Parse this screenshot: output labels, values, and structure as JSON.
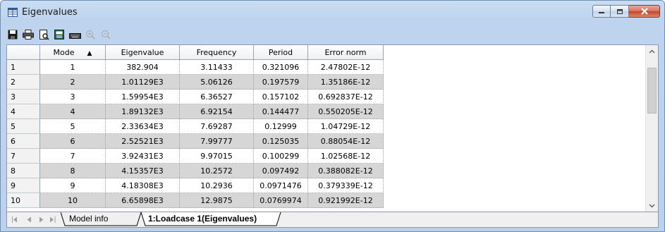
{
  "window": {
    "title": "Eigenvalues",
    "accent": "#bcd2ec",
    "close_color": "#c5432b"
  },
  "toolbar": {
    "icons": [
      "save-icon",
      "print-icon",
      "print-preview-icon",
      "export-icon",
      "keyboard-icon",
      "zoom-in-icon",
      "zoom-out-icon"
    ]
  },
  "table": {
    "columns": [
      "Mode",
      "Eigenvalue",
      "Frequency",
      "Period",
      "Error norm"
    ],
    "sort_indicator": "▲",
    "rows": [
      {
        "n": "1",
        "mode": "1",
        "eig": "382.904",
        "freq": "3.11433",
        "period": "0.321096",
        "err": "2.47802E-12"
      },
      {
        "n": "2",
        "mode": "2",
        "eig": "1.01129E3",
        "freq": "5.06126",
        "period": "0.197579",
        "err": "1.35186E-12"
      },
      {
        "n": "3",
        "mode": "3",
        "eig": "1.59954E3",
        "freq": "6.36527",
        "period": "0.157102",
        "err": "0.692837E-12"
      },
      {
        "n": "4",
        "mode": "4",
        "eig": "1.89132E3",
        "freq": "6.92154",
        "period": "0.144477",
        "err": "0.550205E-12"
      },
      {
        "n": "5",
        "mode": "5",
        "eig": "2.33634E3",
        "freq": "7.69287",
        "period": "0.12999",
        "err": "1.04729E-12"
      },
      {
        "n": "6",
        "mode": "6",
        "eig": "2.52521E3",
        "freq": "7.99777",
        "period": "0.125035",
        "err": "0.88054E-12"
      },
      {
        "n": "7",
        "mode": "7",
        "eig": "3.92431E3",
        "freq": "9.97015",
        "period": "0.100299",
        "err": "1.02568E-12"
      },
      {
        "n": "8",
        "mode": "8",
        "eig": "4.15357E3",
        "freq": "10.2572",
        "period": "0.097492",
        "err": "0.388082E-12"
      },
      {
        "n": "9",
        "mode": "9",
        "eig": "4.18308E3",
        "freq": "10.2936",
        "period": "0.0971476",
        "err": "0.379339E-12"
      },
      {
        "n": "10",
        "mode": "10",
        "eig": "6.65898E3",
        "freq": "12.9875",
        "period": "0.0769974",
        "err": "0.921992E-12"
      }
    ]
  },
  "tabs": {
    "items": [
      "Model info",
      "1:Loadcase 1(Eigenvalues)"
    ],
    "active_index": 1
  }
}
